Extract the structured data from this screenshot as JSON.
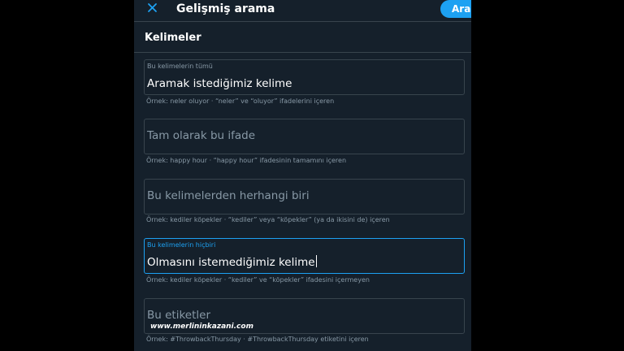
{
  "header": {
    "close_icon": "close-icon",
    "title": "Gelişmiş arama",
    "search_button": "Ara",
    "accent_color": "#1da1f2"
  },
  "section": {
    "title": "Kelimeler"
  },
  "fields": [
    {
      "label": "Bu kelimelerin tümü",
      "value": "Aramak istediğimiz kelime",
      "hint": "Örnek: neler oluyor · “neler” ve “oluyor” ifadelerini içeren"
    },
    {
      "placeholder": "Tam olarak bu ifade",
      "hint": "Örnek: happy hour · “happy hour” ifadesinin tamamını içeren"
    },
    {
      "placeholder": "Bu kelimelerden herhangi biri",
      "hint": "Örnek: kediler köpekler · “kediler” veya “köpekler” (ya da ikisini de) içeren"
    },
    {
      "label": "Bu kelimelerin hiçbiri",
      "value": "Olmasını istemediğimiz kelime",
      "hint": "Örnek: kediler köpekler · “kediler” ve “köpekler” ifadesini içermeyen",
      "focused": true
    },
    {
      "placeholder": "Bu etiketler",
      "hint": "Örnek: #ThrowbackThursday · #ThrowbackThursday etiketini içeren"
    }
  ],
  "watermark": "www.merlininkazani.com"
}
